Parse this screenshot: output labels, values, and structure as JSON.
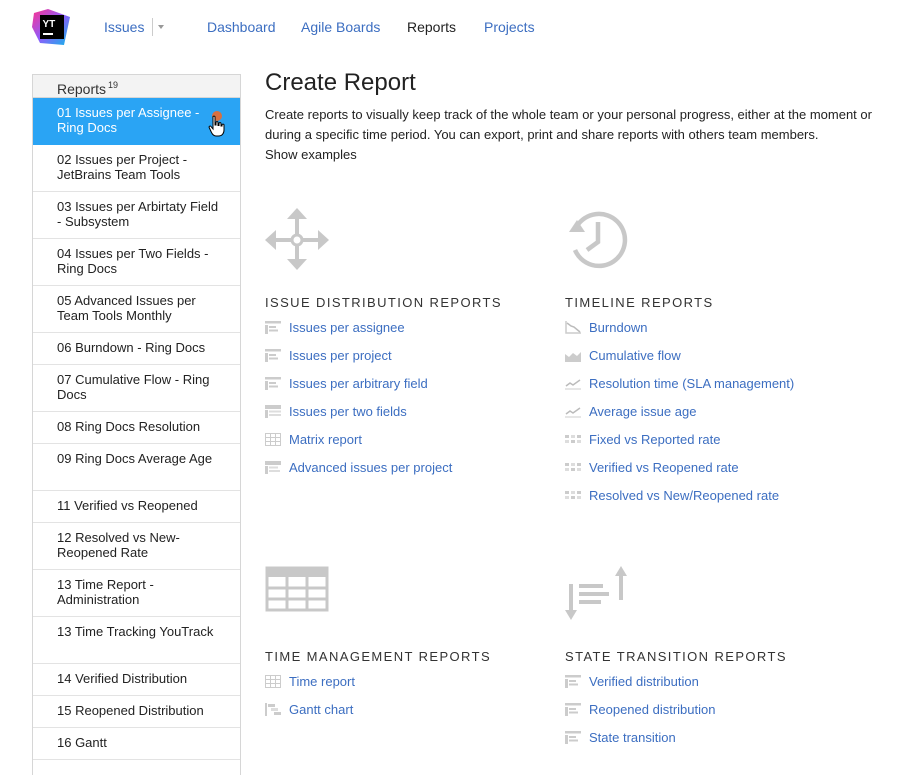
{
  "app": {
    "logo_text": "YT"
  },
  "nav": {
    "issues": "Issues",
    "dashboard": "Dashboard",
    "agile_boards": "Agile Boards",
    "reports": "Reports",
    "projects": "Projects"
  },
  "sidebar": {
    "title": "Reports",
    "count": "19",
    "items": [
      {
        "label": "01 Issues per Assignee - Ring Docs",
        "selected": true
      },
      {
        "label": "02 Issues per Project - JetBrains Team Tools"
      },
      {
        "label": "03 Issues per Arbirtaty Field - Subsystem"
      },
      {
        "label": "04 Issues per Two Fields - Ring Docs"
      },
      {
        "label": "05 Advanced Issues per Team Tools Monthly"
      },
      {
        "label": "06 Burndown - Ring Docs"
      },
      {
        "label": "07 Cumulative Flow - Ring Docs"
      },
      {
        "label": "08 Ring Docs Resolution"
      },
      {
        "label": "09 Ring Docs Average Age"
      },
      {
        "label": "11 Verified vs Reopened"
      },
      {
        "label": "12 Resolved vs New-Reopened Rate"
      },
      {
        "label": "13 Time Report - Administration"
      },
      {
        "label": "13 Time Tracking YouTrack"
      },
      {
        "label": "14 Verified Distribution"
      },
      {
        "label": "15 Reopened Distribution"
      },
      {
        "label": "16 Gantt"
      }
    ]
  },
  "main": {
    "title": "Create Report",
    "description": "Create reports to visually keep track of the whole team or your personal progress, either at the moment or during a specific time period. You can export, print and share reports with others team members.",
    "show_examples": "Show examples",
    "sections": {
      "issue_distribution": {
        "title": "ISSUE DISTRIBUTION REPORTS",
        "links": [
          "Issues per assignee",
          "Issues per project",
          "Issues per arbitrary field",
          "Issues per two fields",
          "Matrix report",
          "Advanced issues per project"
        ]
      },
      "timeline": {
        "title": "TIMELINE REPORTS",
        "links": [
          "Burndown",
          "Cumulative flow",
          "Resolution time (SLA management)",
          "Average issue age",
          "Fixed vs Reported rate",
          "Verified vs Reopened rate",
          "Resolved vs New/Reopened rate"
        ]
      },
      "time_management": {
        "title": "TIME MANAGEMENT REPORTS",
        "links": [
          "Time report",
          "Gantt chart"
        ]
      },
      "state_transition": {
        "title": "STATE TRANSITION REPORTS",
        "links": [
          "Verified distribution",
          "Reopened distribution",
          "State transition"
        ]
      }
    }
  },
  "colors": {
    "link": "#3c6ec1",
    "selected": "#2aa4f4",
    "icon_gray": "#c8c8c8",
    "badge": "#d8703f"
  }
}
